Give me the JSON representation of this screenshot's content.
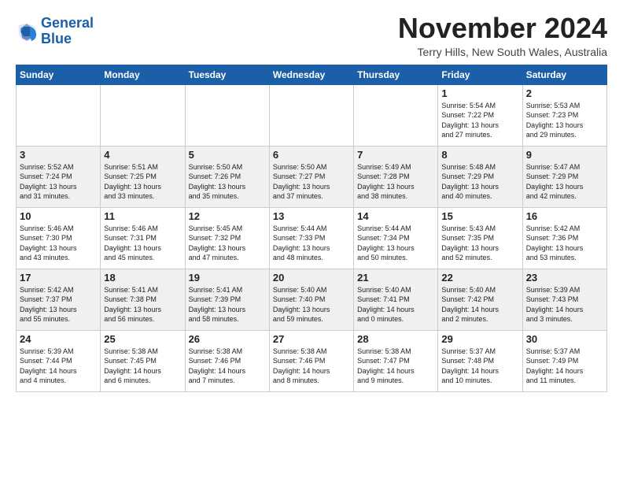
{
  "logo": {
    "line1": "General",
    "line2": "Blue"
  },
  "title": "November 2024",
  "subtitle": "Terry Hills, New South Wales, Australia",
  "days_of_week": [
    "Sunday",
    "Monday",
    "Tuesday",
    "Wednesday",
    "Thursday",
    "Friday",
    "Saturday"
  ],
  "weeks": [
    [
      {
        "day": "",
        "info": ""
      },
      {
        "day": "",
        "info": ""
      },
      {
        "day": "",
        "info": ""
      },
      {
        "day": "",
        "info": ""
      },
      {
        "day": "",
        "info": ""
      },
      {
        "day": "1",
        "info": "Sunrise: 5:54 AM\nSunset: 7:22 PM\nDaylight: 13 hours\nand 27 minutes."
      },
      {
        "day": "2",
        "info": "Sunrise: 5:53 AM\nSunset: 7:23 PM\nDaylight: 13 hours\nand 29 minutes."
      }
    ],
    [
      {
        "day": "3",
        "info": "Sunrise: 5:52 AM\nSunset: 7:24 PM\nDaylight: 13 hours\nand 31 minutes."
      },
      {
        "day": "4",
        "info": "Sunrise: 5:51 AM\nSunset: 7:25 PM\nDaylight: 13 hours\nand 33 minutes."
      },
      {
        "day": "5",
        "info": "Sunrise: 5:50 AM\nSunset: 7:26 PM\nDaylight: 13 hours\nand 35 minutes."
      },
      {
        "day": "6",
        "info": "Sunrise: 5:50 AM\nSunset: 7:27 PM\nDaylight: 13 hours\nand 37 minutes."
      },
      {
        "day": "7",
        "info": "Sunrise: 5:49 AM\nSunset: 7:28 PM\nDaylight: 13 hours\nand 38 minutes."
      },
      {
        "day": "8",
        "info": "Sunrise: 5:48 AM\nSunset: 7:29 PM\nDaylight: 13 hours\nand 40 minutes."
      },
      {
        "day": "9",
        "info": "Sunrise: 5:47 AM\nSunset: 7:29 PM\nDaylight: 13 hours\nand 42 minutes."
      }
    ],
    [
      {
        "day": "10",
        "info": "Sunrise: 5:46 AM\nSunset: 7:30 PM\nDaylight: 13 hours\nand 43 minutes."
      },
      {
        "day": "11",
        "info": "Sunrise: 5:46 AM\nSunset: 7:31 PM\nDaylight: 13 hours\nand 45 minutes."
      },
      {
        "day": "12",
        "info": "Sunrise: 5:45 AM\nSunset: 7:32 PM\nDaylight: 13 hours\nand 47 minutes."
      },
      {
        "day": "13",
        "info": "Sunrise: 5:44 AM\nSunset: 7:33 PM\nDaylight: 13 hours\nand 48 minutes."
      },
      {
        "day": "14",
        "info": "Sunrise: 5:44 AM\nSunset: 7:34 PM\nDaylight: 13 hours\nand 50 minutes."
      },
      {
        "day": "15",
        "info": "Sunrise: 5:43 AM\nSunset: 7:35 PM\nDaylight: 13 hours\nand 52 minutes."
      },
      {
        "day": "16",
        "info": "Sunrise: 5:42 AM\nSunset: 7:36 PM\nDaylight: 13 hours\nand 53 minutes."
      }
    ],
    [
      {
        "day": "17",
        "info": "Sunrise: 5:42 AM\nSunset: 7:37 PM\nDaylight: 13 hours\nand 55 minutes."
      },
      {
        "day": "18",
        "info": "Sunrise: 5:41 AM\nSunset: 7:38 PM\nDaylight: 13 hours\nand 56 minutes."
      },
      {
        "day": "19",
        "info": "Sunrise: 5:41 AM\nSunset: 7:39 PM\nDaylight: 13 hours\nand 58 minutes."
      },
      {
        "day": "20",
        "info": "Sunrise: 5:40 AM\nSunset: 7:40 PM\nDaylight: 13 hours\nand 59 minutes."
      },
      {
        "day": "21",
        "info": "Sunrise: 5:40 AM\nSunset: 7:41 PM\nDaylight: 14 hours\nand 0 minutes."
      },
      {
        "day": "22",
        "info": "Sunrise: 5:40 AM\nSunset: 7:42 PM\nDaylight: 14 hours\nand 2 minutes."
      },
      {
        "day": "23",
        "info": "Sunrise: 5:39 AM\nSunset: 7:43 PM\nDaylight: 14 hours\nand 3 minutes."
      }
    ],
    [
      {
        "day": "24",
        "info": "Sunrise: 5:39 AM\nSunset: 7:44 PM\nDaylight: 14 hours\nand 4 minutes."
      },
      {
        "day": "25",
        "info": "Sunrise: 5:38 AM\nSunset: 7:45 PM\nDaylight: 14 hours\nand 6 minutes."
      },
      {
        "day": "26",
        "info": "Sunrise: 5:38 AM\nSunset: 7:46 PM\nDaylight: 14 hours\nand 7 minutes."
      },
      {
        "day": "27",
        "info": "Sunrise: 5:38 AM\nSunset: 7:46 PM\nDaylight: 14 hours\nand 8 minutes."
      },
      {
        "day": "28",
        "info": "Sunrise: 5:38 AM\nSunset: 7:47 PM\nDaylight: 14 hours\nand 9 minutes."
      },
      {
        "day": "29",
        "info": "Sunrise: 5:37 AM\nSunset: 7:48 PM\nDaylight: 14 hours\nand 10 minutes."
      },
      {
        "day": "30",
        "info": "Sunrise: 5:37 AM\nSunset: 7:49 PM\nDaylight: 14 hours\nand 11 minutes."
      }
    ]
  ]
}
